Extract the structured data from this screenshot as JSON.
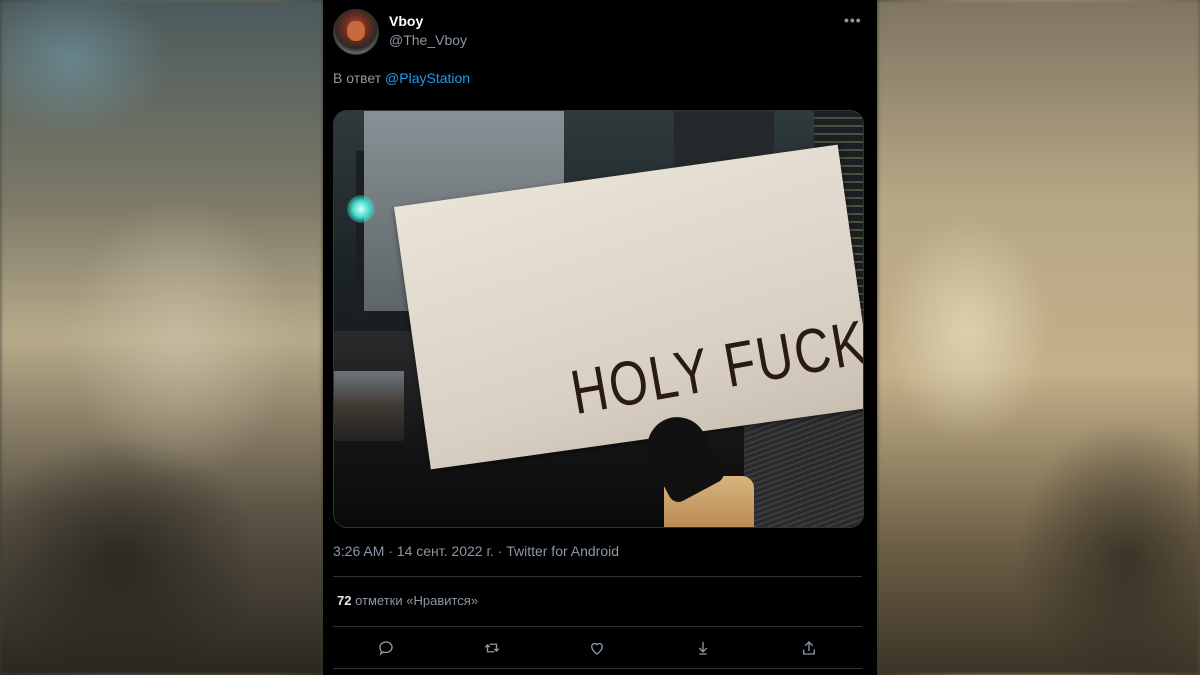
{
  "tweet": {
    "display_name": "Vboy",
    "handle": "@The_Vboy",
    "more_label": "•••",
    "reply_prefix": "В ответ",
    "reply_mention": "@PlayStation",
    "image_text": "HOLY FUCK",
    "timestamp": "3:26 AM · 14 сент. 2022 г. · Twitter for Android",
    "likes_count": "72",
    "likes_label": "отметки «Нравится»"
  },
  "actions": [
    {
      "icon": "reply-icon"
    },
    {
      "icon": "retweet-icon"
    },
    {
      "icon": "like-icon"
    },
    {
      "icon": "bookmark-icon"
    },
    {
      "icon": "share-icon"
    }
  ],
  "colors": {
    "background": "#000000",
    "text": "#e7e9ea",
    "secondary": "#8b98a5",
    "accent": "#1d9bf0"
  }
}
